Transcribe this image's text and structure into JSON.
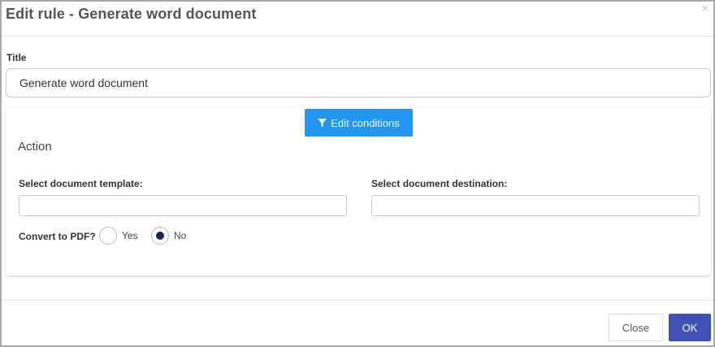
{
  "dialog": {
    "title": "Edit rule - Generate word document",
    "close_symbol": "×"
  },
  "form": {
    "title_label": "Title",
    "title_value": "Generate word document"
  },
  "action": {
    "edit_conditions_label": "Edit conditions",
    "edit_conditions_icon": "filter-icon",
    "heading": "Action",
    "template_label": "Select document template:",
    "template_value": "",
    "destination_label": "Select document destination:",
    "destination_value": "",
    "pdf_label": "Convert to PDF?",
    "pdf_options": [
      {
        "label": "Yes",
        "selected": false
      },
      {
        "label": "No",
        "selected": true
      }
    ]
  },
  "footer": {
    "close_label": "Close",
    "ok_label": "OK"
  },
  "colors": {
    "primary_button": "#2196f3",
    "ok_button": "#3f51b5",
    "radio_selected": "#1a2456"
  }
}
